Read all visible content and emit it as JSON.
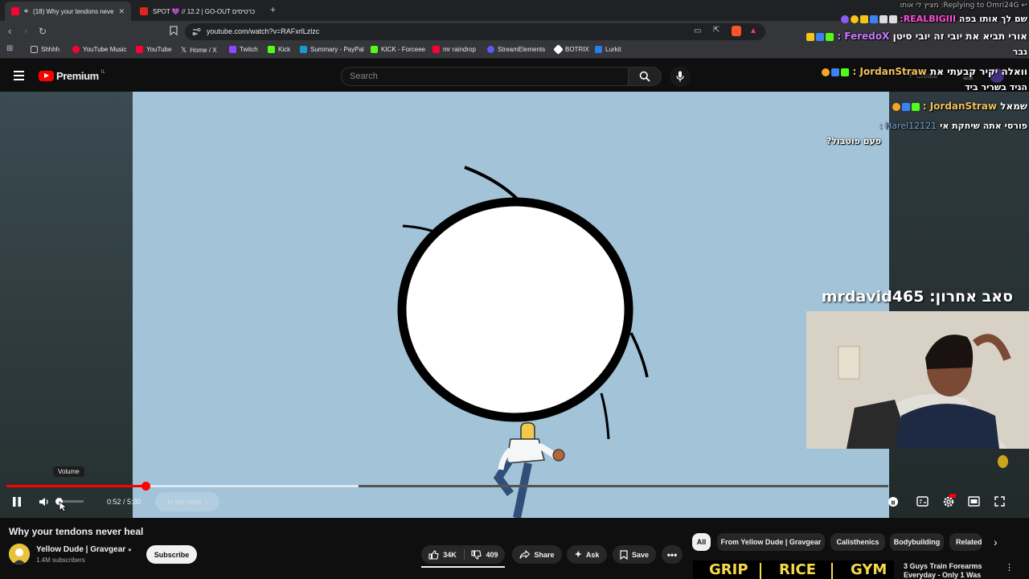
{
  "browser": {
    "tabs": [
      {
        "label": "(18) Why your tendons never",
        "active": true
      },
      {
        "label": "SPOT 💜 // 12.2 | GO-OUT כרטיסים",
        "active": false
      }
    ],
    "new_tab": "+",
    "url": "youtube.com/watch?v=RAFxrlLzlzc",
    "bookmarks": [
      {
        "label": "Shhhh",
        "color": "#bdc1c6"
      },
      {
        "label": "YouTube Music",
        "color": "#ff0033"
      },
      {
        "label": "YouTube",
        "color": "#ff0033"
      },
      {
        "label": "Home / X",
        "color": "#ffffff"
      },
      {
        "label": "Twitch",
        "color": "#9146ff"
      },
      {
        "label": "Kick",
        "color": "#53fc18"
      },
      {
        "label": "Summary - PayPal",
        "color": "#179bd7"
      },
      {
        "label": "KICK - Forceee",
        "color": "#53fc18"
      },
      {
        "label": "mr raindrop",
        "color": "#ff0033"
      },
      {
        "label": "StreamElements",
        "color": "#5a5af5"
      },
      {
        "label": "BOTRIX",
        "color": "#ffffff"
      },
      {
        "label": "Lurkit",
        "color": "#2b7de9"
      }
    ]
  },
  "youtube": {
    "logo_text": "Premium",
    "logo_sup": "IL",
    "search_placeholder": "Search",
    "create_label": "Create"
  },
  "player": {
    "time": "0:52 / 5:30",
    "in_video": "In this video",
    "volume_tooltip": "Volume",
    "progress_fraction": 0.1576,
    "buffer_fraction": 0.4,
    "volume_fraction": 0.1
  },
  "chat": {
    "reply_header": "Replying to Omri24G: מציץ לי אותו",
    "messages": [
      {
        "user": "REALBIGIII:",
        "text": "שם לך אותו בפה",
        "user_color": "#ff4fd8"
      },
      {
        "user": "FeredoX :",
        "text": "אורי תביא את יובי זה יובי סיטן",
        "user_color": "#c678ff"
      },
      {
        "user": "",
        "text": "גבר",
        "user_color": "#ffffff"
      },
      {
        "user": "JordanStraw :",
        "text": "וואלה יקיר קבעתי את",
        "user_color": "#f0c060"
      },
      {
        "user": "",
        "text": "הגיד בשריר ביד",
        "user_color": "#ffffff"
      },
      {
        "user": "JordanStraw :",
        "text": "שמאל",
        "user_color": "#f0c060"
      },
      {
        "user": "Harel12121 :",
        "text": "פורסי אתה שיחקת אי",
        "user_color": "#7da7d9"
      },
      {
        "user": "",
        "text": "פעם פוטבול?",
        "user_color": "#ffffff"
      }
    ],
    "last_sub_label": "סאב אחרון:",
    "last_sub_user": "mrdavid465"
  },
  "video": {
    "title": "Why your tendons never heal",
    "channel": "Yellow Dude | Gravgear",
    "subscribers": "1.4M subscribers",
    "subscribe_label": "Subscribe",
    "likes": "34K",
    "dislikes": "409",
    "share": "Share",
    "ask": "Ask",
    "save": "Save"
  },
  "related_chips": [
    "All",
    "From Yellow Dude | Gravgear",
    "Calisthenics",
    "Bodybuilding",
    "Related"
  ],
  "recommendation": {
    "thumb_words": [
      "GRIP",
      "RICE",
      "GYM"
    ],
    "title": "3 Guys Train Forearms Everyday - Only 1 Was"
  }
}
